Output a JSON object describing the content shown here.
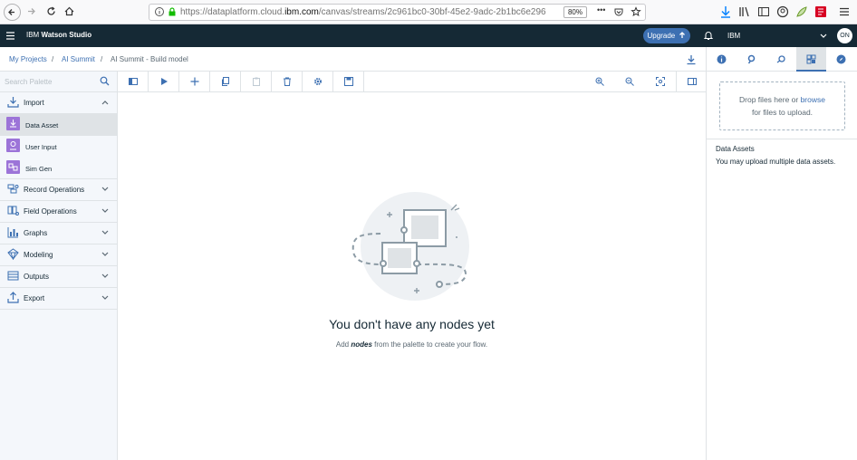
{
  "browser": {
    "url_prefix": "https://dataplatform.cloud.",
    "url_domain": "ibm.com",
    "url_rest": "/canvas/streams/2c961bc0-30bf-45e2-9adc-2b1bc6e296",
    "zoom": "80%",
    "more": "•••"
  },
  "header": {
    "brand": "IBM",
    "product": "Watson Studio",
    "upgrade_label": "Upgrade",
    "account": "IBM",
    "avatar_initials": "ON"
  },
  "breadcrumb": {
    "items": [
      "My Projects",
      "AI Summit",
      "AI Summit - Build model"
    ],
    "sep": "/"
  },
  "palette": {
    "search_placeholder": "Search Palette",
    "import": {
      "label": "Import",
      "nodes": [
        "Data Asset",
        "User Input",
        "Sim Gen"
      ]
    },
    "categories": [
      "Record Operations",
      "Field Operations",
      "Graphs",
      "Modeling",
      "Outputs",
      "Export"
    ]
  },
  "canvas": {
    "empty_title": "You don't have any nodes yet",
    "sub_before": "Add ",
    "sub_em": "nodes",
    "sub_after": " from the palette to create your flow."
  },
  "right_panel": {
    "drop_text_1": "Drop files here or ",
    "browse": "browse",
    "drop_text_2": "for files to upload.",
    "heading": "Data Assets",
    "description": "You may upload multiple data assets."
  },
  "colors": {
    "header_bg": "#152935",
    "accent": "#3d70b2",
    "node_purple": "#9c74d8",
    "palette_bg": "#f4f7fb"
  }
}
